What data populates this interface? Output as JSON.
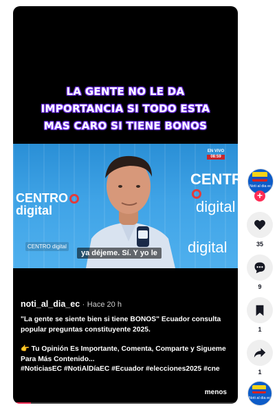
{
  "video": {
    "headline_lines": [
      "LA GENTE NO LE DA",
      "IMPORTANCIA SI TODO ESTA",
      "MAS CARO SI TIENE BONOS"
    ],
    "subtitle": "ya déjeme. Sí. Y yo le",
    "live_badge": "EN VIVO",
    "live_time": "08:59",
    "brand_left": "CENTRO",
    "brand_left_sub": "digital",
    "brand_right": "CENTRO",
    "brand_right_sub": "digital",
    "brand_small": "CENTRO digital",
    "brand_bottom": "digital"
  },
  "post": {
    "author": "noti_al_dia_ec",
    "separator": "·",
    "time_ago": "Hace 20 h",
    "description_line1": "\"La gente se siente bien si tiene BONOS\" Ecuador consulta popular preguntas constituyente 2025.",
    "description_line2": "👉 Tu Opinión Es Importante, Comenta, Comparte y Sigueme Para Más Contenido...",
    "hashtags": "#NoticiasEC #NotiAlDíaEC #Ecuador #elecciones2025 #cne",
    "more_label": "menos",
    "progress_fraction": 0.08
  },
  "sidebar": {
    "avatar_text": "Noti al dia ec",
    "follow_symbol": "+",
    "likes": "35",
    "comments": "9",
    "saves": "1",
    "shares": "1"
  },
  "colors": {
    "accent": "#fe2c55",
    "headline_glow": "#7a3df0",
    "video_blue": "#3fa3e6"
  },
  "icons": [
    "heart-icon",
    "comment-icon",
    "bookmark-icon",
    "share-icon",
    "plus-icon"
  ]
}
